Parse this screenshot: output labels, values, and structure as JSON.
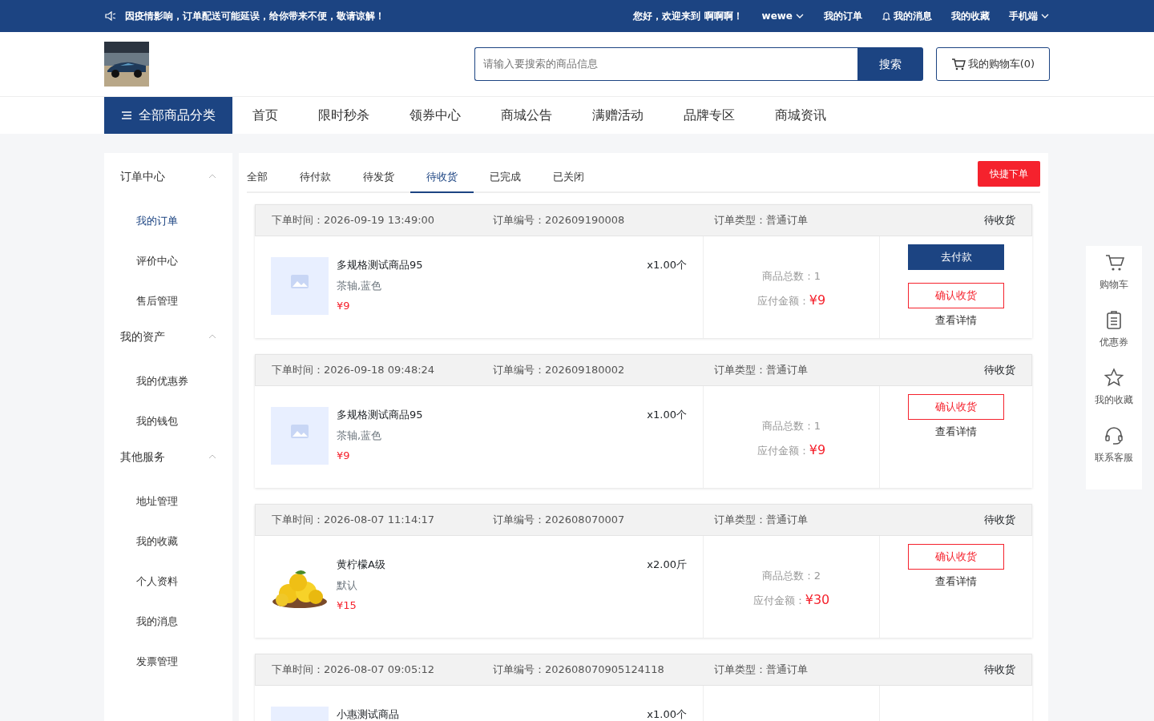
{
  "notice": "因疫情影响，订单配送可能延误，给你带来不便，敬请谅解！",
  "top_links": [
    {
      "label": "您好，欢迎来到 啊啊啊！",
      "kind": "text"
    },
    {
      "label": "wewe",
      "kind": "dropdown"
    },
    {
      "label": "我的订单",
      "kind": "link"
    },
    {
      "label": "我的消息",
      "kind": "bell"
    },
    {
      "label": "我的收藏",
      "kind": "link"
    },
    {
      "label": "手机端",
      "kind": "dropdown"
    }
  ],
  "search": {
    "placeholder": "请输入要搜索的商品信息",
    "button": "搜索"
  },
  "cart_button": "我的购物车(0)",
  "category_button": "全部商品分类",
  "nav": [
    "首页",
    "限时秒杀",
    "领券中心",
    "商城公告",
    "满赠活动",
    "品牌专区",
    "商城资讯"
  ],
  "sidebar": [
    {
      "title": "订单中心",
      "expanded": true,
      "items": [
        {
          "label": "我的订单",
          "selected": true
        },
        {
          "label": "评价中心",
          "selected": false
        },
        {
          "label": "售后管理",
          "selected": false
        }
      ]
    },
    {
      "title": "我的资产",
      "expanded": true,
      "items": [
        {
          "label": "我的优惠券",
          "selected": false
        },
        {
          "label": "我的钱包",
          "selected": false
        }
      ]
    },
    {
      "title": "其他服务",
      "expanded": true,
      "items": [
        {
          "label": "地址管理",
          "selected": false
        },
        {
          "label": "我的收藏",
          "selected": false
        },
        {
          "label": "个人资料",
          "selected": false
        },
        {
          "label": "我的消息",
          "selected": false
        },
        {
          "label": "发票管理",
          "selected": false
        }
      ]
    }
  ],
  "tabs": [
    {
      "label": "全部",
      "selected": false
    },
    {
      "label": "待付款",
      "selected": false
    },
    {
      "label": "待发货",
      "selected": false
    },
    {
      "label": "待收货",
      "selected": true
    },
    {
      "label": "已完成",
      "selected": false
    },
    {
      "label": "已关闭",
      "selected": false
    }
  ],
  "quick_order_button": "快捷下单",
  "orders": [
    {
      "time": "下单时间：2026-09-19 13:49:00",
      "number": "订单编号：202609190008",
      "type": "订单类型：普通订单",
      "status": "待收货",
      "product": {
        "name": "多规格测试商品95",
        "spec": "茶轴,蓝色",
        "price": "¥9",
        "qty": "x1.00个"
      },
      "count": "商品总数：1",
      "amount_label": "应付金额：",
      "amount": "¥9",
      "actions": [
        {
          "label": "去付款",
          "kind": "primary"
        },
        {
          "label": "确认收货",
          "kind": "outline"
        },
        {
          "label": "查看详情",
          "kind": "link"
        }
      ]
    },
    {
      "time": "下单时间：2026-09-18 09:48:24",
      "number": "订单编号：202609180002",
      "type": "订单类型：普通订单",
      "status": "待收货",
      "product": {
        "name": "多规格测试商品95",
        "spec": "茶轴,蓝色",
        "price": "¥9",
        "qty": "x1.00个"
      },
      "count": "商品总数：1",
      "amount_label": "应付金额：",
      "amount": "¥9",
      "actions": [
        {
          "label": "确认收货",
          "kind": "outline"
        },
        {
          "label": "查看详情",
          "kind": "link"
        }
      ]
    },
    {
      "time": "下单时间：2026-08-07 11:14:17",
      "number": "订单编号：202608070007",
      "type": "订单类型：普通订单",
      "status": "待收货",
      "product": {
        "kind": "picture",
        "name": "黄柠檬A级",
        "spec": "默认",
        "price": "¥15",
        "qty": "x2.00斤"
      },
      "count": "商品总数：2",
      "amount_label": "应付金额：",
      "amount": "¥30",
      "actions": [
        {
          "label": "确认收货",
          "kind": "outline"
        },
        {
          "label": "查看详情",
          "kind": "link"
        }
      ]
    },
    {
      "time": "下单时间：2026-08-07 09:05:12",
      "number": "订单编号：202608070905124118",
      "type": "订单类型：普通订单",
      "status": "待收货",
      "product": {
        "name": "小惠测试商品",
        "qty": "x1.00个"
      }
    }
  ],
  "float_bar": [
    {
      "label": "购物车"
    },
    {
      "label": "优惠券"
    },
    {
      "label": "我的收藏"
    },
    {
      "label": "联系客服"
    }
  ]
}
